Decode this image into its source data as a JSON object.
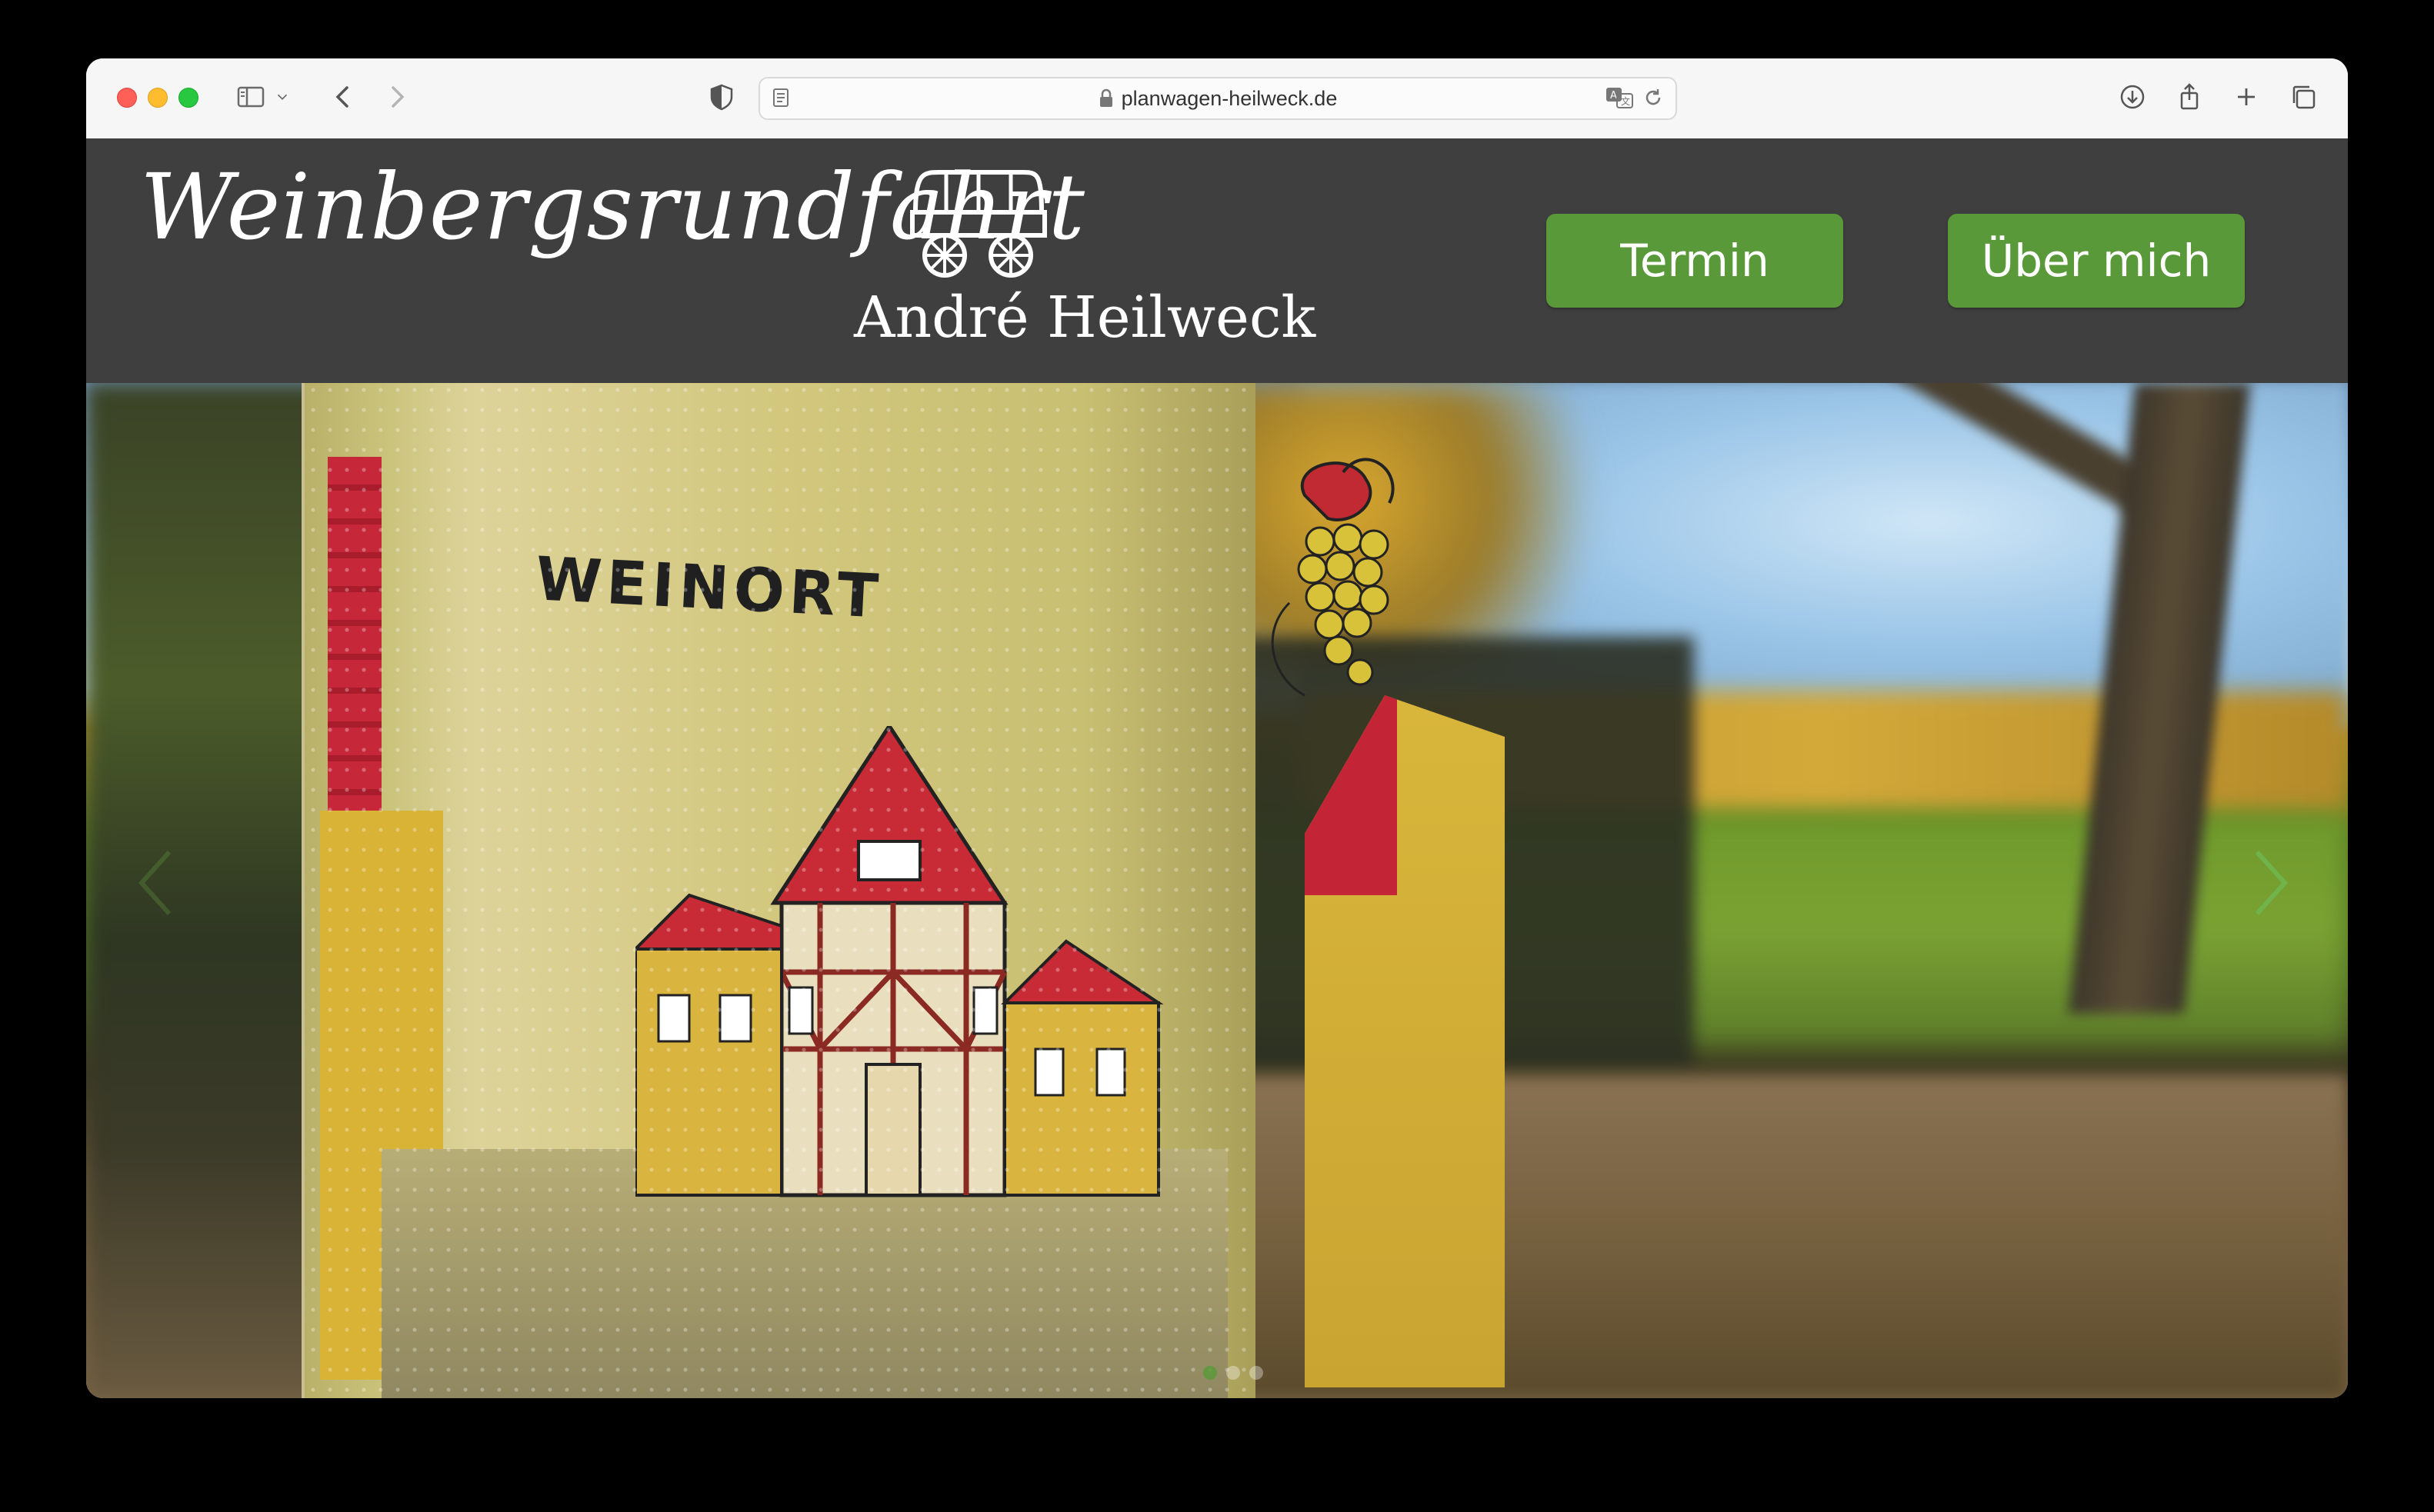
{
  "browser": {
    "url": "planwagen-heilweck.de",
    "icons": [
      "sidebar-icon",
      "chevron-down-icon",
      "back-icon",
      "forward-icon",
      "shield-icon",
      "reader-icon",
      "lock-icon",
      "translate-icon",
      "reload-icon",
      "download-icon",
      "share-icon",
      "new-tab-icon",
      "tabs-overview-icon"
    ]
  },
  "site": {
    "logo_script": "Weinbergsrundfahrt",
    "logo_name": "André Heilweck",
    "nav": {
      "termin": "Termin",
      "about": "Über mich"
    },
    "colors": {
      "header_bg": "#3f3f3f",
      "button_green": "#5a993a"
    }
  },
  "hero": {
    "glass_text": "WEINORT",
    "slides_total": 3,
    "active_slide": 1
  }
}
